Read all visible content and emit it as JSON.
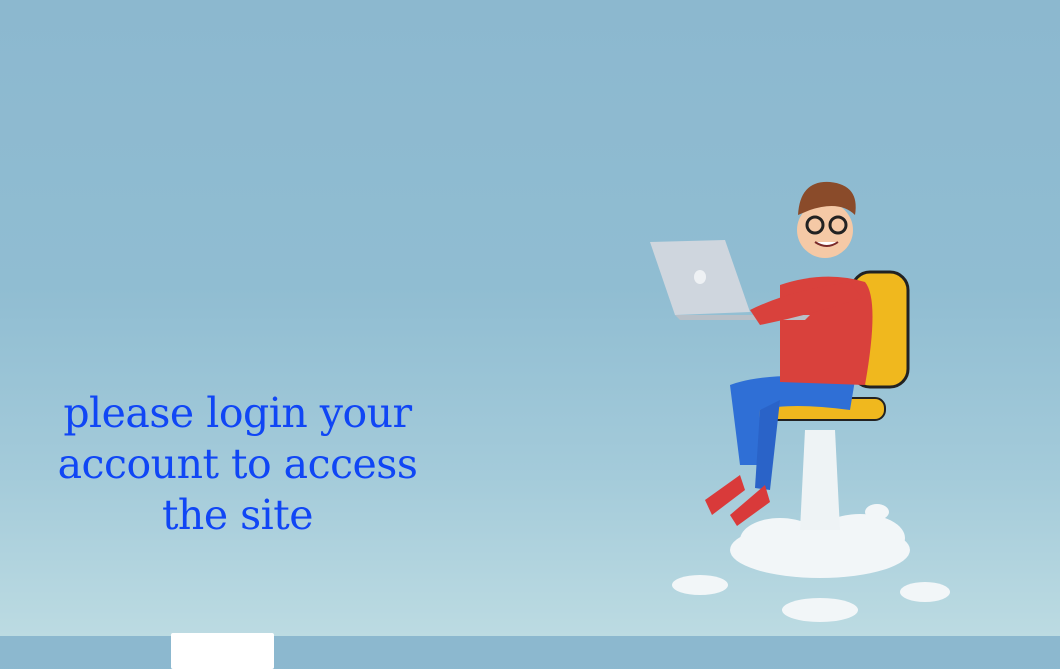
{
  "hero": {
    "message": "please login your account to access the site",
    "accent_color": "#1046f5",
    "illustration": "person-on-rocket-chair-with-laptop"
  }
}
